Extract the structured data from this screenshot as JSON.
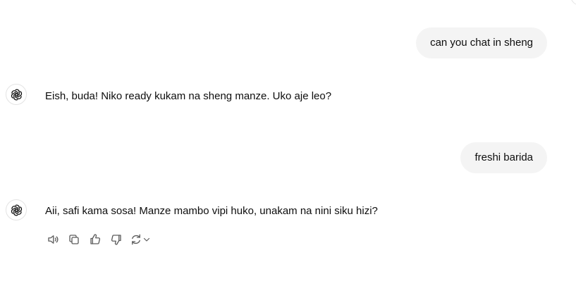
{
  "messages": [
    {
      "role": "user",
      "text": "can you chat in sheng"
    },
    {
      "role": "assistant",
      "text": "Eish, buda! Niko ready kukam na sheng manze. Uko aje leo?"
    },
    {
      "role": "user",
      "text": "freshi barida"
    },
    {
      "role": "assistant",
      "text": "Aii, safi kama sosa! Manze mambo vipi huko, unakam na nini siku hizi?"
    }
  ],
  "assistant_avatar_icon": "openai-logo-icon",
  "actions": [
    {
      "icon": "speaker-icon"
    },
    {
      "icon": "copy-icon"
    },
    {
      "icon": "thumbs-up-icon"
    },
    {
      "icon": "thumbs-down-icon"
    },
    {
      "icon": "regenerate-icon"
    }
  ],
  "colors": {
    "user_bubble": "#f4f4f4",
    "text": "#0d0d0d",
    "icon": "#5d5d5d"
  }
}
